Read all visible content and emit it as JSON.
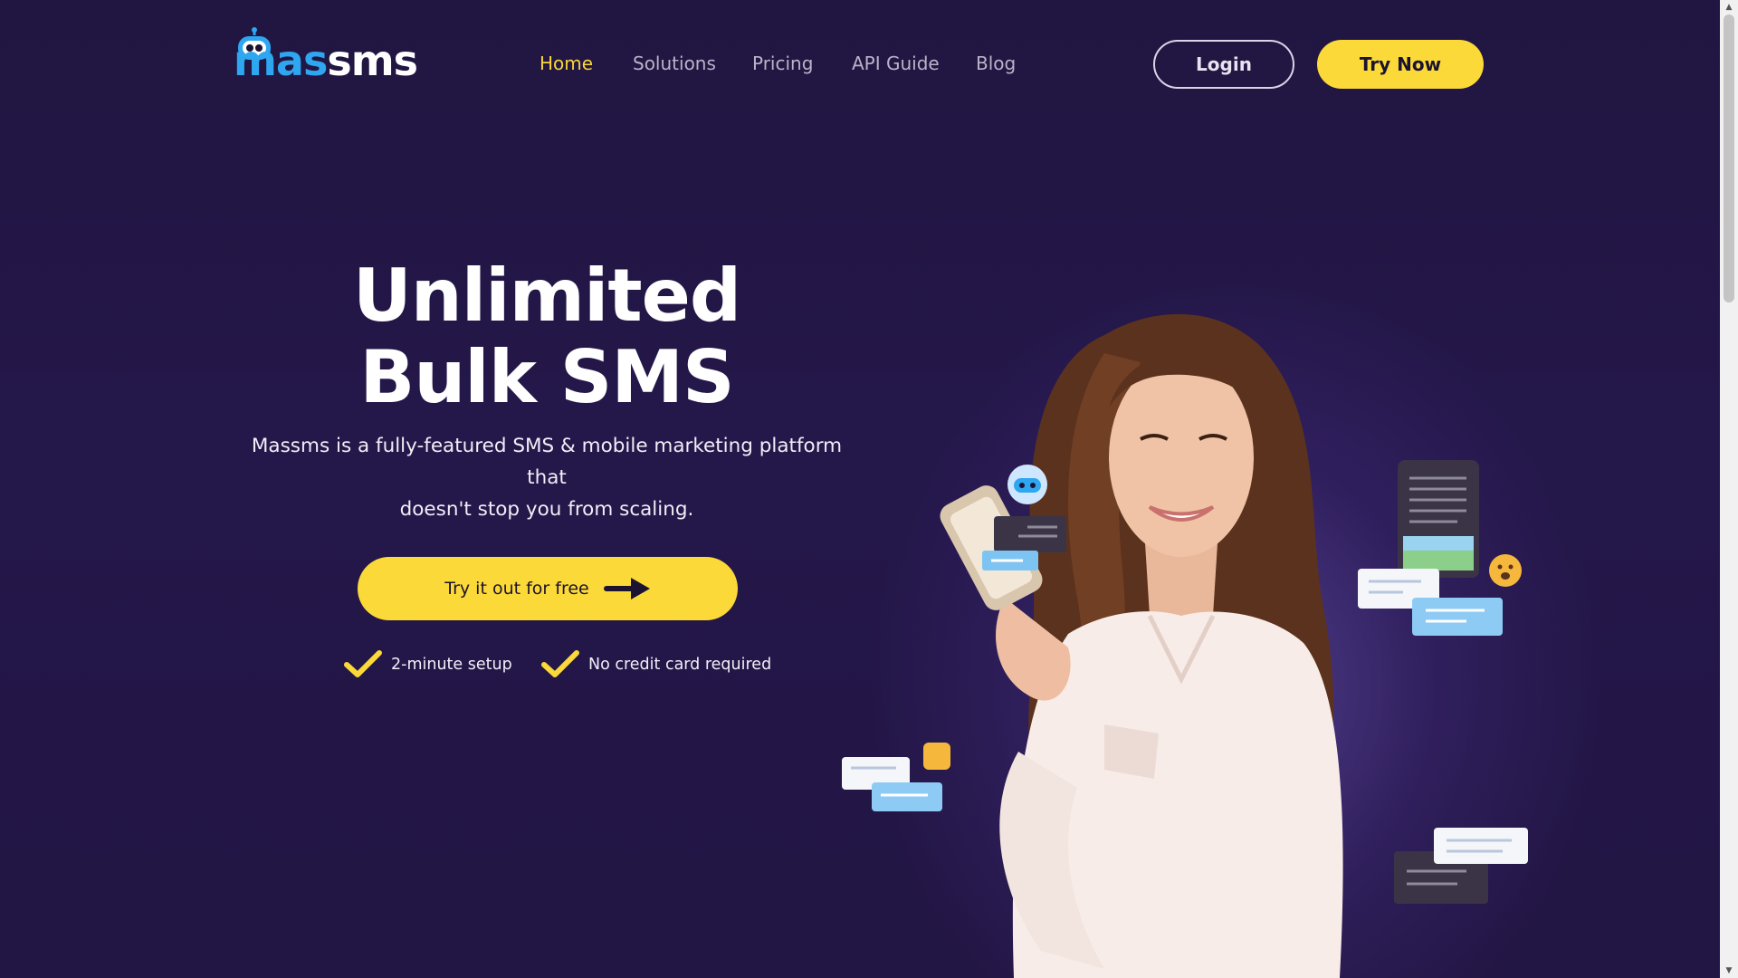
{
  "logo": {
    "part1": "mas",
    "part2": "sms",
    "icon": "robot-icon"
  },
  "nav": {
    "items": [
      {
        "label": "Home",
        "active": true
      },
      {
        "label": "Solutions",
        "active": false
      },
      {
        "label": "Pricing",
        "active": false
      },
      {
        "label": "API Guide",
        "active": false
      },
      {
        "label": "Blog",
        "active": false
      }
    ]
  },
  "header": {
    "login_label": "Login",
    "try_label": "Try Now"
  },
  "hero": {
    "title_line1": "Unlimited",
    "title_line2": "Bulk SMS",
    "subtitle_line1": "Massms is a fully-featured SMS & mobile marketing platform that",
    "subtitle_line2": "doesn't stop you from scaling.",
    "cta_label": "Try it out for free",
    "cta_icon": "arrow-right-icon",
    "checks": [
      {
        "label": "2-minute setup",
        "icon": "check-icon"
      },
      {
        "label": "No credit card required",
        "icon": "check-icon"
      }
    ]
  },
  "colors": {
    "background": "#221644",
    "accent_yellow": "#fbd938",
    "brand_blue": "#2fa6f0",
    "nav_inactive": "#b9b4c9"
  },
  "scrollbar": {
    "up_icon": "chevron-up-icon",
    "down_icon": "chevron-down-icon"
  }
}
